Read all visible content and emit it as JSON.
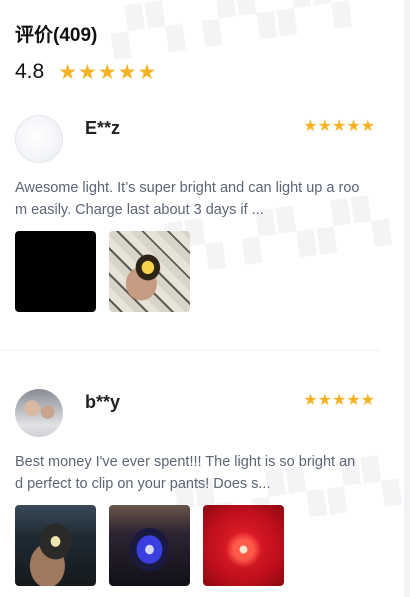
{
  "header": {
    "title": "评价(409)"
  },
  "overall": {
    "score": "4.8",
    "stars": 5
  },
  "reviews": [
    {
      "username": "E**z",
      "rating": 5,
      "text": "Awesome light. It’s super bright and can light up a room easily. Charge last about 3 days if ...",
      "images": [
        "black-photo",
        "lamp-photo"
      ]
    },
    {
      "username": "b**y",
      "rating": 5,
      "text": "Best money I've ever spent!!! The light is so bright and perfect to clip on your pants! Does s...",
      "images": [
        "lamp-dark-photo",
        "lamp-blue-photo",
        "lamp-red-photo"
      ]
    }
  ],
  "icons": {
    "star": "star-icon"
  },
  "colors": {
    "star": "#f5b324",
    "review_text": "#5c6575"
  }
}
